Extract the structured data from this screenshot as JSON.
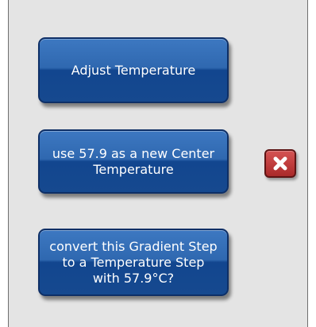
{
  "dialog": {
    "buttons": [
      {
        "label": "Adjust Temperature"
      },
      {
        "label": "use 57.9 as a new Center\nTemperature"
      },
      {
        "label": "convert this Gradient Step\nto a Temperature Step\nwith 57.9°C?"
      }
    ],
    "close_icon": "close-icon",
    "colors": {
      "panel_bg": "#e4e4e4",
      "button_blue": "#1f5aa6",
      "close_red": "#c13e3e"
    }
  }
}
